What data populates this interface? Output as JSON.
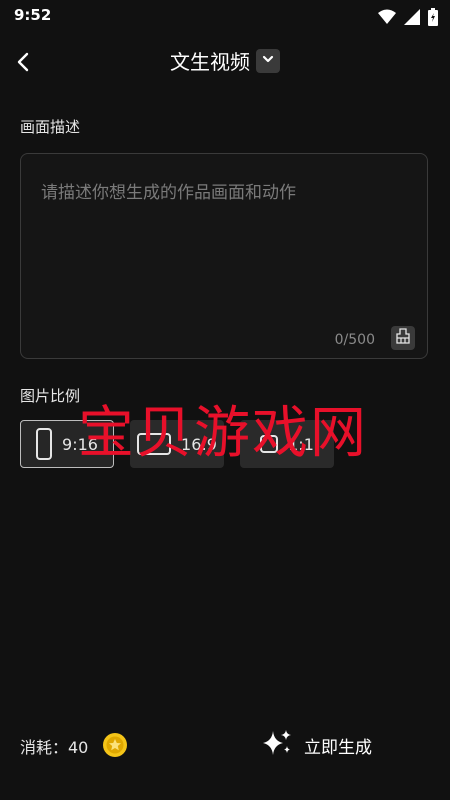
{
  "status_bar": {
    "time": "9:52",
    "icons": [
      "wifi-icon",
      "signal-icon",
      "battery-icon"
    ]
  },
  "header": {
    "title": "文生视频",
    "back_icon": "chevron-left-icon",
    "dropdown_icon": "chevron-down-icon"
  },
  "description": {
    "label": "画面描述",
    "placeholder": "请描述你想生成的作品画面和动作",
    "value": "",
    "char_count": "0/500",
    "clear_icon": "eraser-icon"
  },
  "aspect_ratio": {
    "label": "图片比例",
    "options": [
      {
        "label": "9:16",
        "selected": true
      },
      {
        "label": "16:9",
        "selected": false
      },
      {
        "label": "1:1",
        "selected": false
      }
    ]
  },
  "watermark": "宝贝游戏网",
  "footer": {
    "cost_label": "消耗：40",
    "coin_icon": "coin-icon",
    "generate_label": "立即生成",
    "generate_icon": "sparkle-icon"
  },
  "colors": {
    "background": "#111111",
    "watermark": "#e8102a",
    "coin": "#f5c518"
  }
}
